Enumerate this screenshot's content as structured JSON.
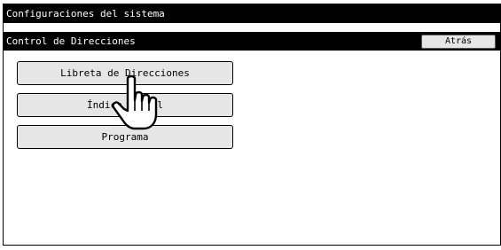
{
  "header": {
    "title": "Configuraciones del sistema",
    "subtitle": "Control de Direcciones",
    "back_label": "Atrás"
  },
  "menu": {
    "items": [
      {
        "label": "Libreta de Direcciones"
      },
      {
        "label": "Índice Global"
      },
      {
        "label": "Programa"
      }
    ]
  },
  "colors": {
    "bar": "#000000",
    "button": "#e6e6e6"
  },
  "icons": {
    "pointer": "hand-pointer-icon"
  }
}
